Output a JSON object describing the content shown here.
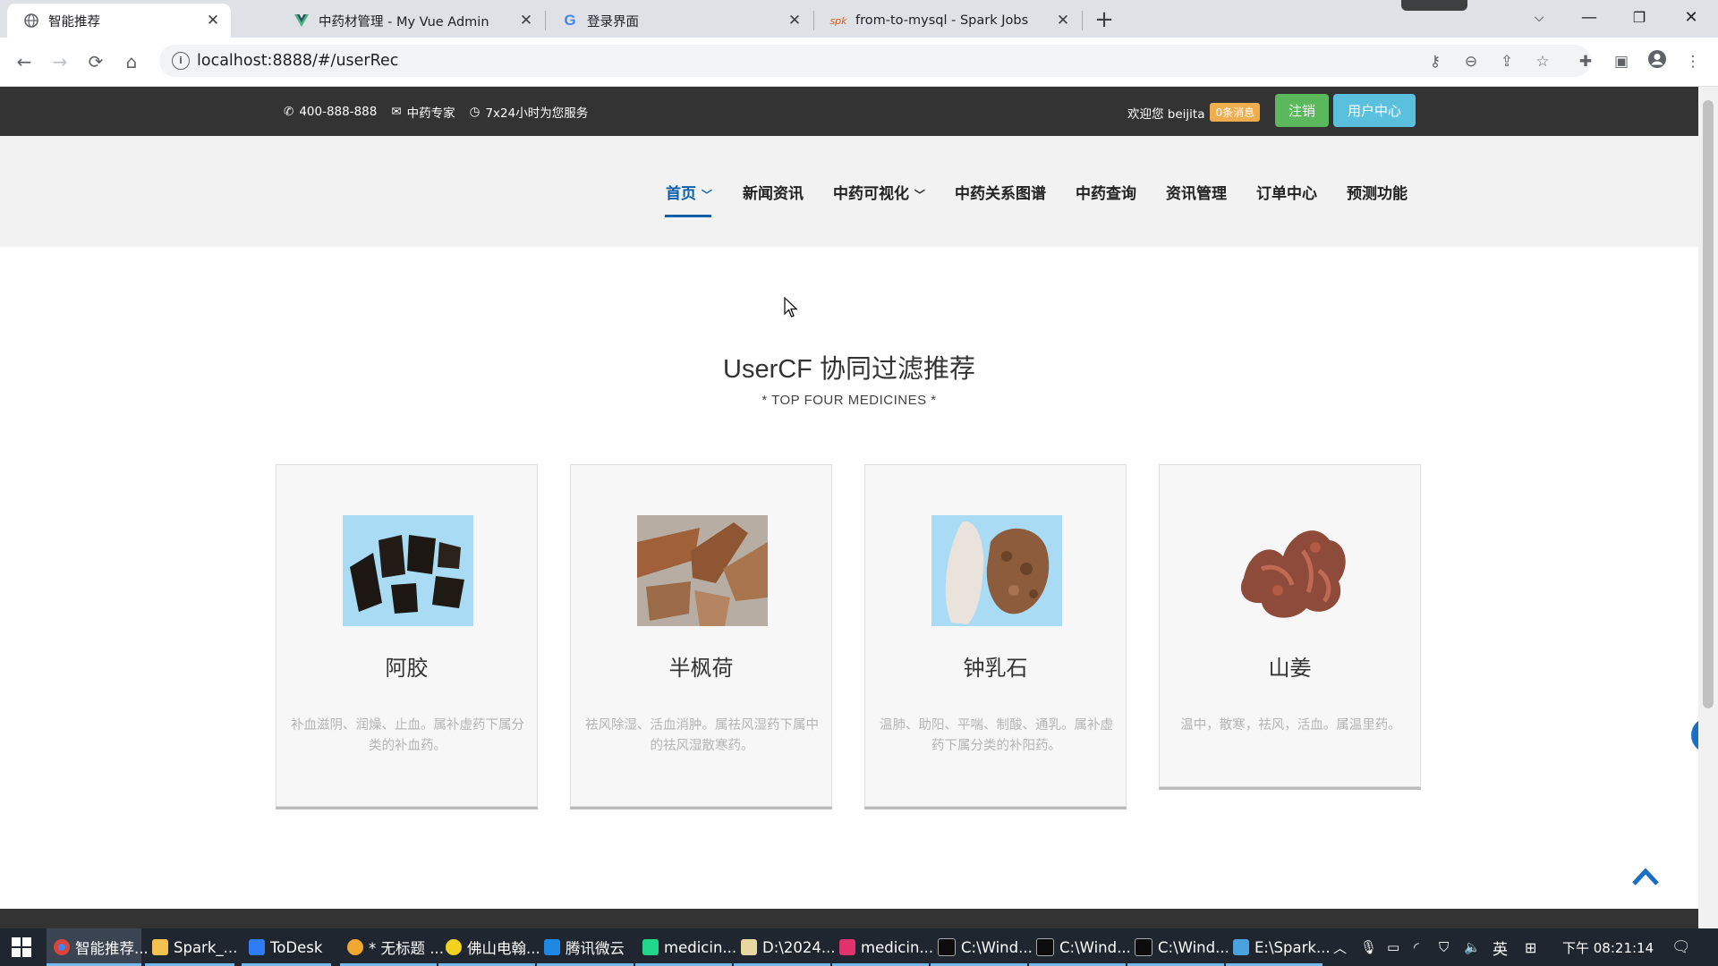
{
  "browser": {
    "tabs": [
      {
        "title": "智能推荐",
        "icon": "globe-icon",
        "active": true
      },
      {
        "title": "中药材管理 - My Vue Admin",
        "icon": "vue-logo-icon",
        "active": false
      },
      {
        "title": "登录界面",
        "icon": "google-g-icon",
        "active": false
      },
      {
        "title": "from-to-mysql - Spark Jobs",
        "icon": "spark-logo-icon",
        "active": false
      }
    ],
    "url": "localhost:8888/#/userRec"
  },
  "site": {
    "phone": "400-888-888",
    "expert": "中药专家",
    "service": "7x24小时为您服务",
    "welcome": "欢迎您 beijita",
    "messages_badge": "0条消息",
    "logout_label": "注销",
    "user_center_label": "用户中心",
    "nav": [
      {
        "label": "首页",
        "dropdown": true,
        "active": true
      },
      {
        "label": "新闻资讯",
        "dropdown": false,
        "active": false
      },
      {
        "label": "中药可视化",
        "dropdown": true,
        "active": false
      },
      {
        "label": "中药关系图谱",
        "dropdown": false,
        "active": false
      },
      {
        "label": "中药查询",
        "dropdown": false,
        "active": false
      },
      {
        "label": "资讯管理",
        "dropdown": false,
        "active": false
      },
      {
        "label": "订单中心",
        "dropdown": false,
        "active": false
      },
      {
        "label": "预测功能",
        "dropdown": false,
        "active": false
      }
    ]
  },
  "section": {
    "title": "UserCF 协同过滤推荐",
    "subtitle": "* TOP FOUR MEDICINES *"
  },
  "cards": [
    {
      "name": "阿胶",
      "desc": "补血滋阴、润燥、止血。属补虚药下属分类的补血药。"
    },
    {
      "name": "半枫荷",
      "desc": "祛风除湿、活血消肿。属祛风湿药下属中的祛风湿散寒药。"
    },
    {
      "name": "钟乳石",
      "desc": "温肺、助阳、平喘、制酸、通乳。属补虚药下属分类的补阳药。"
    },
    {
      "name": "山姜",
      "desc": "温中，散寒，祛风，活血。属温里药。"
    }
  ],
  "taskbar": {
    "items": [
      "智能推荐...",
      "Spark_...",
      "ToDesk",
      "* 无标题 ...",
      "佛山电翰...",
      "腾讯微云",
      "medicin...",
      "D:\\2024...",
      "medicin...",
      "C:\\Wind...",
      "C:\\Wind...",
      "C:\\Wind...",
      "E:\\Spark..."
    ],
    "ime": "英",
    "clock": "下午 08:21:14"
  }
}
